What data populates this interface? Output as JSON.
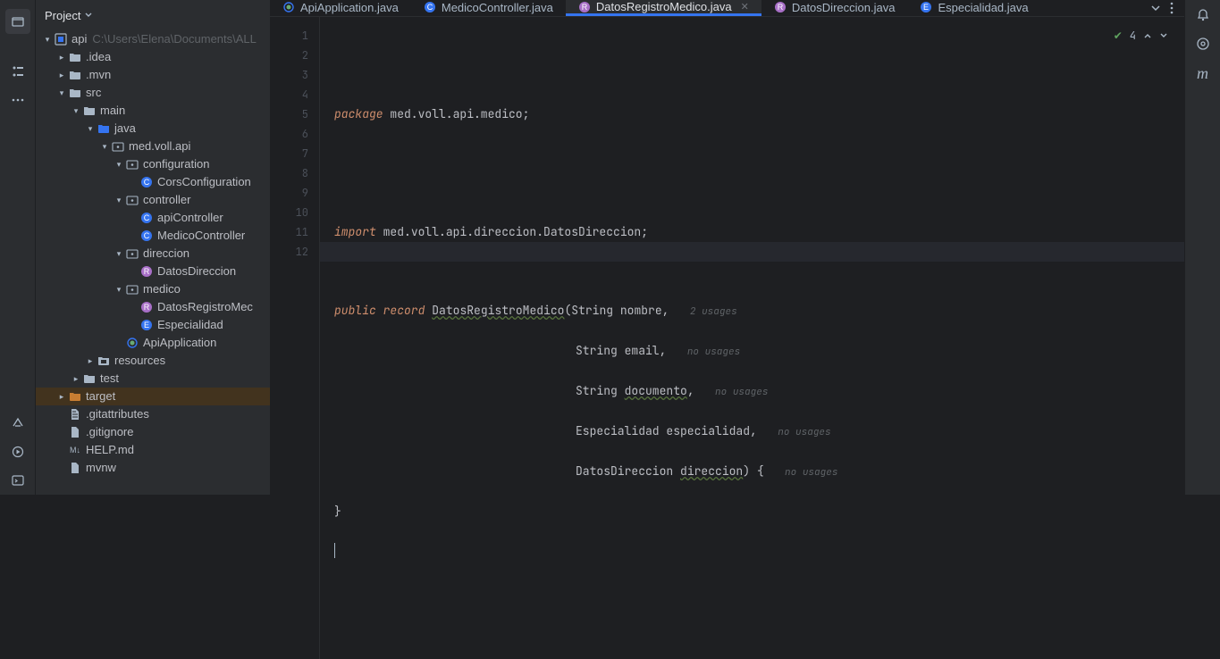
{
  "sidebar": {
    "title": "Project",
    "root": {
      "name": "api",
      "path": "C:\\Users\\Elena\\Documents\\ALL"
    },
    "items": {
      "idea": ".idea",
      "mvn": ".mvn",
      "src": "src",
      "main": "main",
      "java": "java",
      "pkg": "med.voll.api",
      "configuration": "configuration",
      "corsConfig": "CorsConfiguration",
      "controller": "controller",
      "apiController": "apiController",
      "medicoController": "MedicoController",
      "direccion": "direccion",
      "datosDireccion": "DatosDireccion",
      "medico": "medico",
      "datosRegistroMedico": "DatosRegistroMec",
      "especialidad": "Especialidad",
      "apiApplication": "ApiApplication",
      "resources": "resources",
      "test": "test",
      "target": "target",
      "gitattributes": ".gitattributes",
      "gitignore": ".gitignore",
      "help": "HELP.md",
      "mvnw": "mvnw"
    }
  },
  "tabs": {
    "t1": "ApiApplication.java",
    "t2": "MedicoController.java",
    "t3": "DatosRegistroMedico.java",
    "t4": "DatosDireccion.java",
    "t5": "Especialidad.java"
  },
  "status": {
    "problems": "4"
  },
  "code": {
    "l1_kw": "package",
    "l1_rest": " med.voll.api.medico;",
    "l4_kw": "import",
    "l4_rest": " med.voll.api.direccion.DatosDireccion;",
    "l6_pub": "public",
    "l6_rec": "record",
    "l6_name": "DatosRegistroMedico",
    "l6_sig": "(String nombre,",
    "l6_usage": "2 usages",
    "l7_text": "String email,",
    "l7_usage": "no usages",
    "l8_text": "String ",
    "l8_under": "documento",
    "l8_tail": ",",
    "l8_usage": "no usages",
    "l9_text": "Especialidad especialidad,",
    "l9_usage": "no usages",
    "l10_type": "DatosDireccion ",
    "l10_under": "direccion",
    "l10_tail": ") {",
    "l10_usage": "no usages",
    "l11": "}",
    "lines": [
      "1",
      "2",
      "3",
      "4",
      "5",
      "6",
      "7",
      "8",
      "9",
      "10",
      "11",
      "12"
    ]
  },
  "right": {
    "m": "m"
  }
}
